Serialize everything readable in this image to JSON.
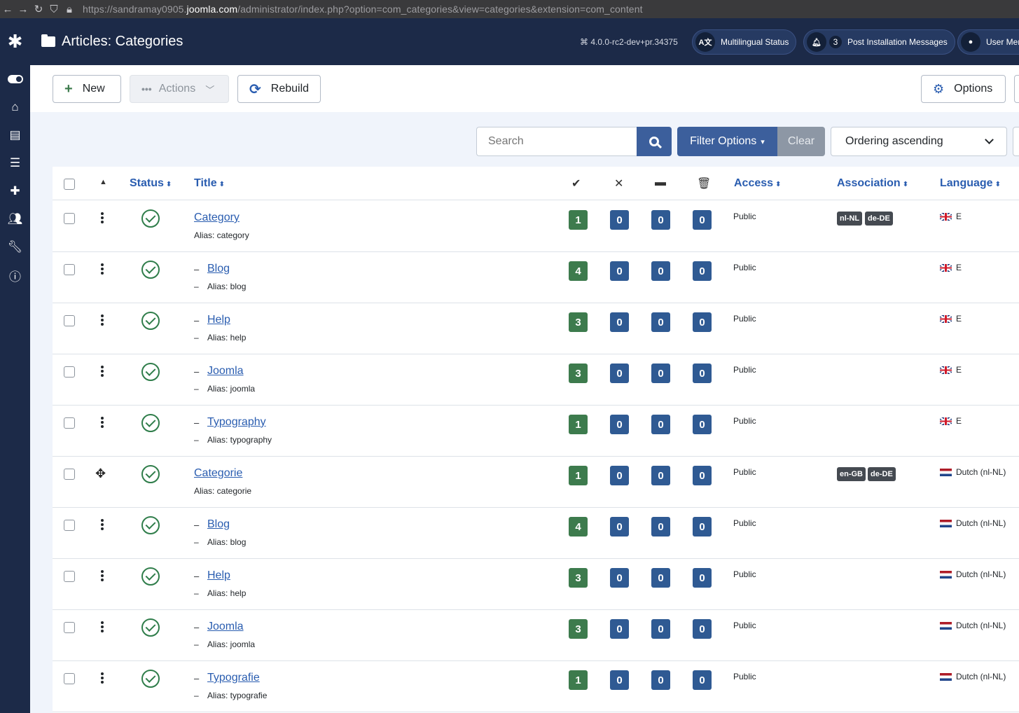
{
  "browser": {
    "url_prefix": "https://sandramay0905.",
    "url_domain": "joomla.com",
    "url_suffix": "/administrator/index.php?option=com_categories&view=categories&extension=com_content"
  },
  "header": {
    "title": "Articles: Categories",
    "version": "⌘ 4.0.0-rc2-dev+pr.34375",
    "multilingual_label": "Multilingual Status",
    "post_install_count": "3",
    "post_install_label": "Post Installation Messages",
    "user_menu_label": "User Menu"
  },
  "toolbar": {
    "new_label": "New",
    "actions_label": "Actions",
    "rebuild_label": "Rebuild",
    "options_label": "Options"
  },
  "filters": {
    "search_placeholder": "Search",
    "filter_options_label": "Filter Options",
    "clear_label": "Clear",
    "ordering_value": "Ordering ascending"
  },
  "table": {
    "headers": {
      "status": "Status",
      "title": "Title",
      "access": "Access",
      "association": "Association",
      "language": "Language"
    },
    "rows": [
      {
        "title": "Category",
        "alias": "Alias: category",
        "level": 0,
        "published": "1",
        "unpublished": "0",
        "archived": "0",
        "trashed": "0",
        "access": "Public",
        "assoc": [
          "nl-NL",
          "de-DE"
        ],
        "lang": "E",
        "flag": "uk"
      },
      {
        "title": "Blog",
        "alias": "Alias: blog",
        "level": 1,
        "published": "4",
        "unpublished": "0",
        "archived": "0",
        "trashed": "0",
        "access": "Public",
        "assoc": [],
        "lang": "E",
        "flag": "uk"
      },
      {
        "title": "Help",
        "alias": "Alias: help",
        "level": 1,
        "published": "3",
        "unpublished": "0",
        "archived": "0",
        "trashed": "0",
        "access": "Public",
        "assoc": [],
        "lang": "E",
        "flag": "uk"
      },
      {
        "title": "Joomla",
        "alias": "Alias: joomla",
        "level": 1,
        "published": "3",
        "unpublished": "0",
        "archived": "0",
        "trashed": "0",
        "access": "Public",
        "assoc": [],
        "lang": "E",
        "flag": "uk"
      },
      {
        "title": "Typography",
        "alias": "Alias: typography",
        "level": 1,
        "published": "1",
        "unpublished": "0",
        "archived": "0",
        "trashed": "0",
        "access": "Public",
        "assoc": [],
        "lang": "E",
        "flag": "uk"
      },
      {
        "title": "Categorie",
        "alias": "Alias: categorie",
        "level": 0,
        "published": "1",
        "unpublished": "0",
        "archived": "0",
        "trashed": "0",
        "access": "Public",
        "assoc": [
          "en-GB",
          "de-DE"
        ],
        "lang": "Dutch (nl-NL)",
        "flag": "nl"
      },
      {
        "title": "Blog",
        "alias": "Alias: blog",
        "level": 1,
        "published": "4",
        "unpublished": "0",
        "archived": "0",
        "trashed": "0",
        "access": "Public",
        "assoc": [],
        "lang": "Dutch (nl-NL)",
        "flag": "nl"
      },
      {
        "title": "Help",
        "alias": "Alias: help",
        "level": 1,
        "published": "3",
        "unpublished": "0",
        "archived": "0",
        "trashed": "0",
        "access": "Public",
        "assoc": [],
        "lang": "Dutch (nl-NL)",
        "flag": "nl"
      },
      {
        "title": "Joomla",
        "alias": "Alias: joomla",
        "level": 1,
        "published": "3",
        "unpublished": "0",
        "archived": "0",
        "trashed": "0",
        "access": "Public",
        "assoc": [],
        "lang": "Dutch (nl-NL)",
        "flag": "nl"
      },
      {
        "title": "Typografie",
        "alias": "Alias: typografie",
        "level": 1,
        "published": "1",
        "unpublished": "0",
        "archived": "0",
        "trashed": "0",
        "access": "Public",
        "assoc": [],
        "lang": "Dutch (nl-NL)",
        "flag": "nl"
      }
    ]
  }
}
